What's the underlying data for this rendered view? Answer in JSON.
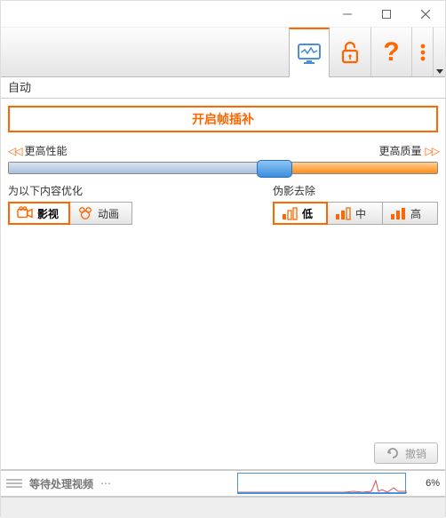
{
  "window": {
    "tab_label": "自动"
  },
  "toolbar": {
    "monitor_icon": "monitor-icon",
    "lock_icon": "lock-icon",
    "help_icon": "help-icon",
    "more_icon": "more-icon"
  },
  "main_button": {
    "label": "开启帧插补"
  },
  "slider": {
    "left_label": "更高性能",
    "right_label": "更高质量",
    "position_percent": 62
  },
  "optimize_group": {
    "label": "为以下内容优化",
    "options": [
      {
        "label": "影视",
        "selected": true
      },
      {
        "label": "动画",
        "selected": false
      }
    ]
  },
  "artifact_group": {
    "label": "伪影去除",
    "options": [
      {
        "label": "低",
        "selected": true
      },
      {
        "label": "中",
        "selected": false
      },
      {
        "label": "高",
        "selected": false
      }
    ]
  },
  "undo": {
    "label": "撤销"
  },
  "status": {
    "waiting_label": "等待处理视频",
    "percent": "6%"
  }
}
